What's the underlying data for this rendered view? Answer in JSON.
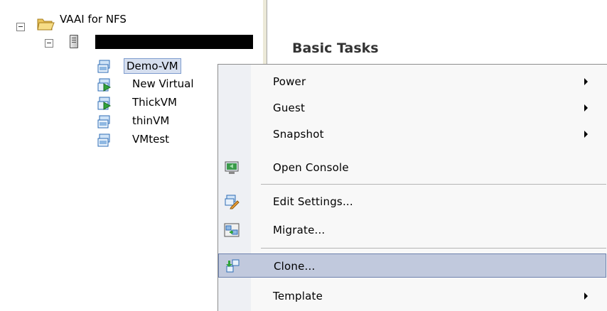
{
  "tree": {
    "root_label": "VAAI for NFS",
    "vms": [
      {
        "name": "Demo-VM",
        "state": "off"
      },
      {
        "name": "New Virtual",
        "state": "on"
      },
      {
        "name": "ThickVM",
        "state": "on"
      },
      {
        "name": "thinVM",
        "state": "off"
      },
      {
        "name": "VMtest",
        "state": "off"
      }
    ]
  },
  "panel": {
    "title": "Basic Tasks"
  },
  "context_menu": {
    "items": [
      {
        "label": "Power",
        "submenu": true
      },
      {
        "label": "Guest",
        "submenu": true
      },
      {
        "label": "Snapshot",
        "submenu": true
      },
      {
        "label": "Open Console",
        "submenu": false,
        "icon": "console-icon"
      },
      {
        "label": "Edit Settings...",
        "submenu": false,
        "icon": "edit-settings-icon"
      },
      {
        "label": "Migrate...",
        "submenu": false,
        "icon": "migrate-icon"
      },
      {
        "label": "Clone...",
        "submenu": false,
        "icon": "clone-icon",
        "highlighted": true
      },
      {
        "label": "Template",
        "submenu": true
      }
    ]
  },
  "colors": {
    "menu_highlight": "#c1c9dd",
    "selection": "#d6dfef"
  }
}
